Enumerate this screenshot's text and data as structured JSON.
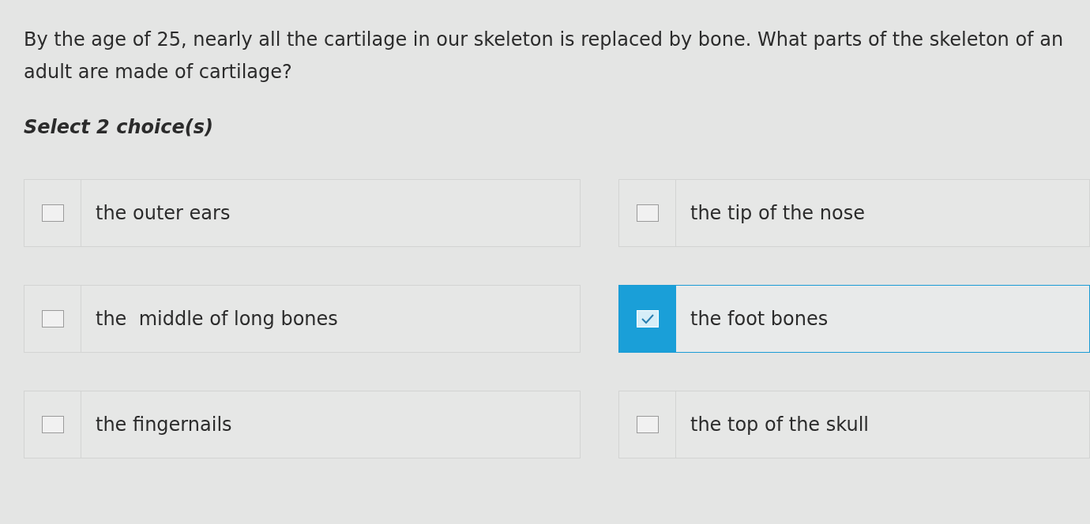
{
  "question": "By the age of 25, nearly all the cartilage in our skeleton is replaced by bone. What parts of the skeleton of an adult are made of cartilage?",
  "instruction": "Select 2 choice(s)",
  "choices": [
    {
      "label": "the outer ears",
      "selected": false
    },
    {
      "label": "the tip of the nose",
      "selected": false
    },
    {
      "label": "the  middle of long bones",
      "selected": false
    },
    {
      "label": "the foot bones",
      "selected": true
    },
    {
      "label": "the fingernails",
      "selected": false
    },
    {
      "label": "the top of the skull",
      "selected": false
    }
  ]
}
